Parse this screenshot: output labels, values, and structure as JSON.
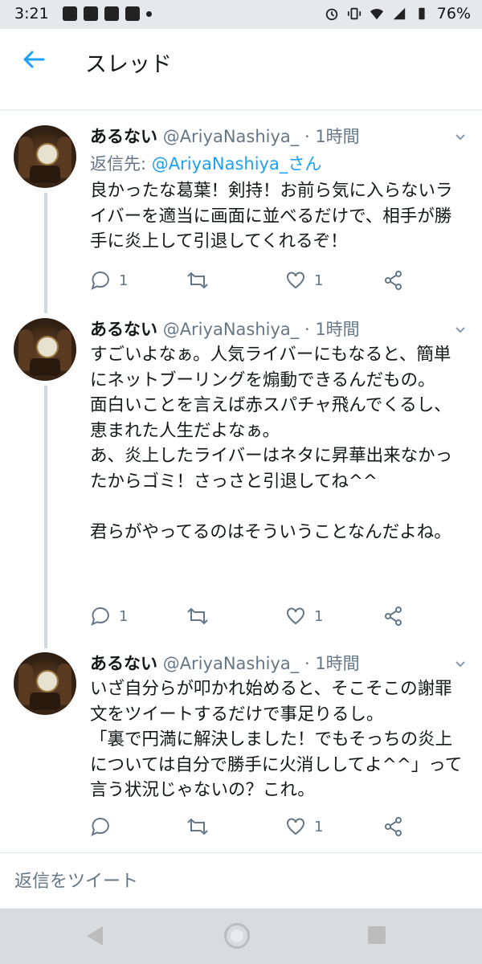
{
  "status_bar": {
    "time": "3:21",
    "battery": "76%"
  },
  "header": {
    "title": "スレッド"
  },
  "tweets": [
    {
      "name": "あるない",
      "handle": "@AriyaNashiya_",
      "time": "· 1時間",
      "reply_prefix": "返信先: ",
      "reply_to": "@AriyaNashiya_さん",
      "text": "良かったな葛葉！剣持！お前ら気に入らないライバーを適当に画面に並べるだけで、相手が勝手に炎上して引退してくれるぞ！",
      "replies": "1",
      "retweets": "",
      "likes": "1"
    },
    {
      "name": "あるない",
      "handle": "@AriyaNashiya_",
      "time": "· 1時間",
      "text": "すごいよなぁ。人気ライバーにもなると、簡単にネットブーリングを煽動できるんだもの。\n面白いことを言えば赤スパチャ飛んでくるし、恵まれた人生だよなぁ。\nあ、炎上したライバーはネタに昇華出来なかったからゴミ！さっさと引退してね^^\n\n君らがやってるのはそういうことなんだよね。",
      "replies": "1",
      "retweets": "",
      "likes": "1"
    },
    {
      "name": "あるない",
      "handle": "@AriyaNashiya_",
      "time": "· 1時間",
      "text": "いざ自分らが叩かれ始めると、そこそこの謝罪文をツイートするだけで事足りるし。\n「裏で円満に解決しました！でもそっちの炎上については自分で勝手に火消ししてよ^^」って言う状況じゃないの？これ。",
      "replies": "",
      "retweets": "",
      "likes": "1"
    }
  ],
  "reply_bar": {
    "placeholder": "返信をツイート"
  },
  "colors": {
    "accent": "#1da1f2",
    "muted": "#657786",
    "line": "#cfd9de"
  }
}
